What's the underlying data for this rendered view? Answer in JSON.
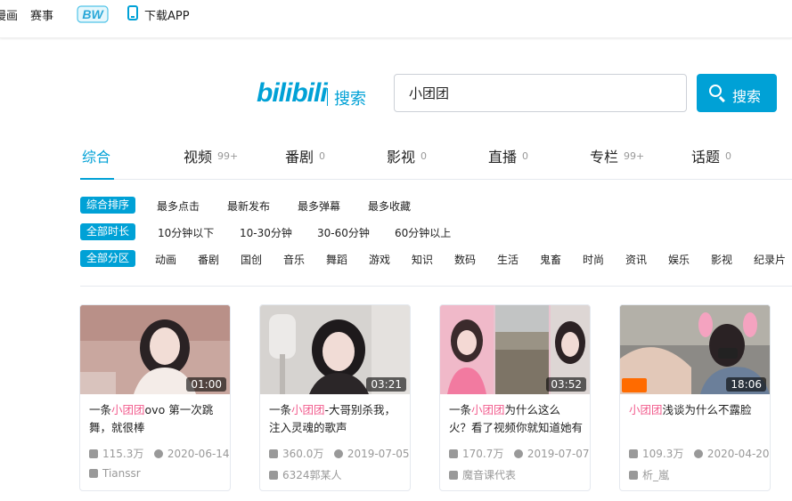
{
  "topbar": {
    "items": [
      "漫画",
      "赛事"
    ],
    "bw_logo": "BW",
    "download": "下载APP"
  },
  "search": {
    "logo": "bilibili",
    "logo_suffix": "搜索",
    "value": "小团团",
    "button": "搜索"
  },
  "tabs": [
    {
      "label": "综合",
      "count": ""
    },
    {
      "label": "视频",
      "count": "99+"
    },
    {
      "label": "番剧",
      "count": "0"
    },
    {
      "label": "影视",
      "count": "0"
    },
    {
      "label": "直播",
      "count": "0"
    },
    {
      "label": "专栏",
      "count": "99+"
    },
    {
      "label": "话题",
      "count": "0"
    }
  ],
  "filters": {
    "sort": {
      "active": "综合排序",
      "options": [
        "最多点击",
        "最新发布",
        "最多弹幕",
        "最多收藏"
      ]
    },
    "duration": {
      "active": "全部时长",
      "options": [
        "10分钟以下",
        "10-30分钟",
        "30-60分钟",
        "60分钟以上"
      ]
    },
    "zone": {
      "active": "全部分区",
      "options": [
        "动画",
        "番剧",
        "国创",
        "音乐",
        "舞蹈",
        "游戏",
        "知识",
        "数码",
        "生活",
        "鬼畜",
        "时尚",
        "资讯",
        "娱乐",
        "影视",
        "纪录片"
      ]
    }
  },
  "cards": [
    {
      "duration": "01:00",
      "t1": "一条",
      "hl": "小团团",
      "t2": "ovo 第一次跳舞，就很棒",
      "views": "115.3万",
      "date": "2020-06-14",
      "uploader": "Tianssr"
    },
    {
      "duration": "03:21",
      "t1": "一条",
      "hl": "小团团",
      "t2": "-大哥别杀我，注入灵魂的歌声",
      "views": "360.0万",
      "date": "2019-07-05",
      "uploader": "6324郭某人"
    },
    {
      "duration": "03:52",
      "t1": "一条",
      "hl": "小团团",
      "t2": "为什么这么火？看了视频你就知道她有多招",
      "views": "170.7万",
      "date": "2019-07-07",
      "uploader": "魔音课代表"
    },
    {
      "duration": "18:06",
      "t1": "",
      "hl": "小团团",
      "t2": "浅谈为什么不露脸",
      "views": "109.3万",
      "date": "2020-04-20",
      "uploader": "析_嵐"
    }
  ],
  "colors": {
    "accent": "#00a1d6",
    "highlight": "#f25d8e"
  }
}
